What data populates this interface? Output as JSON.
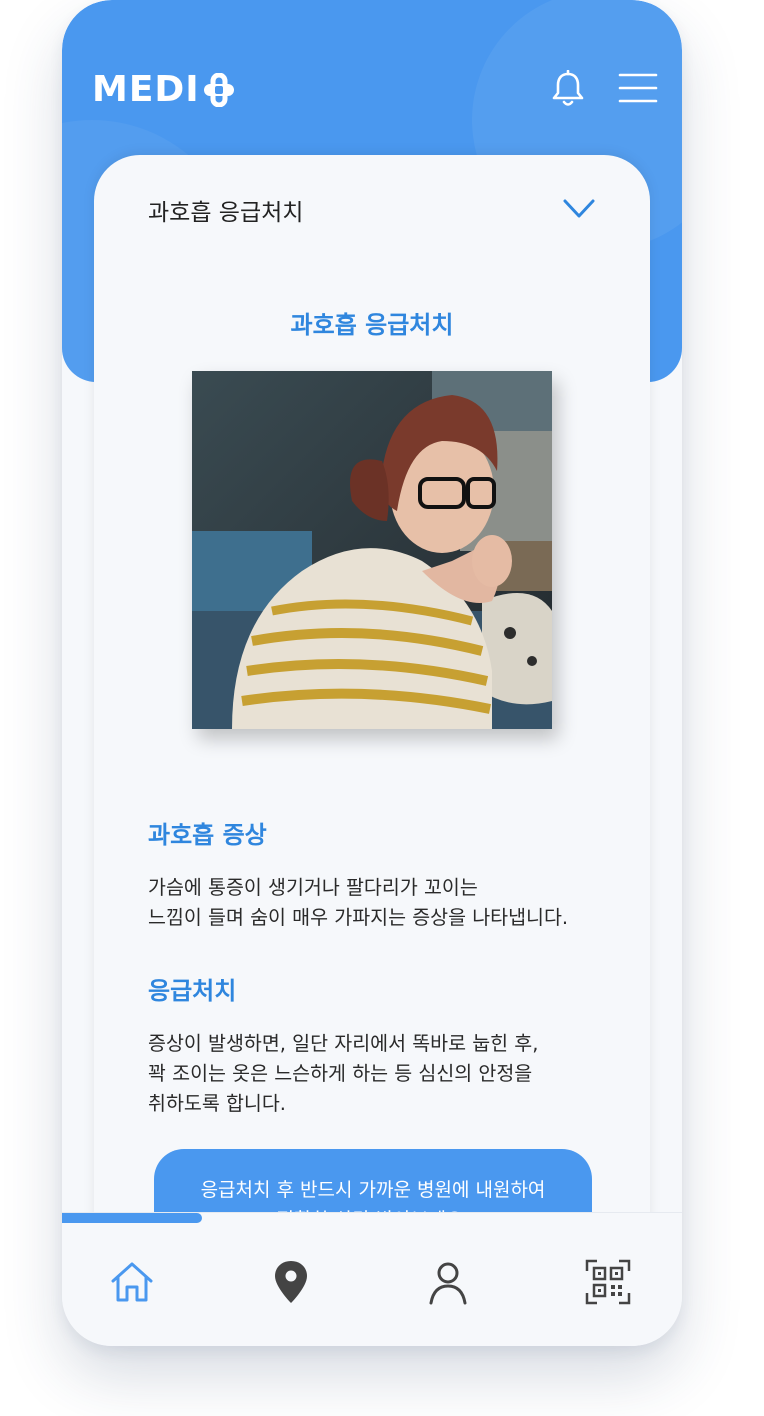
{
  "app": {
    "logo_text": "MEDI",
    "accent_color": "#4a98ef",
    "icons": [
      "bell-icon",
      "menu-icon",
      "chevron-down-icon",
      "home-icon",
      "location-pin-icon",
      "user-icon",
      "qr-code-icon"
    ]
  },
  "card": {
    "dropdown_label": "과호흡 응급처치",
    "section_title": "과호흡 응급처치",
    "symptom_title": "과호흡 증상",
    "symptom_text": "가슴에 통증이 생기거나 팔다리가 꼬이는\n느낌이 들며 숨이 매우 가파지는 증상을 나타냅니다.",
    "firstaid_title": "응급처치",
    "firstaid_text": "증상이 발생하면, 일단 자리에서 똑바로 눕힌 후,\n꽉 조이는 옷은 느슨하게 하는 등 심신의 안정을\n취하도록 합니다.",
    "notice_text": "응급처치 후 반드시 가까운 병원에 내원하여\n정확한 상담 받아보세요."
  },
  "nav": {
    "active_item": "home",
    "active_color": "#4a98ef",
    "inactive_color": "#444444"
  }
}
